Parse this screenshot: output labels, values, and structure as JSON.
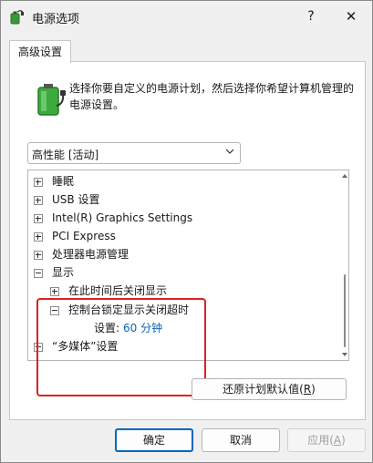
{
  "window": {
    "title": "电源选项",
    "help_label": "?",
    "close_label": "✕"
  },
  "tabs": [
    {
      "label": "高级设置",
      "active": true
    }
  ],
  "description": "选择你要自定义的电源计划，然后选择你希望计算机管理的电源设置。",
  "plan_select": {
    "value": "高性能 [活动]"
  },
  "tree": {
    "items": [
      {
        "label": "睡眠",
        "expander": "plus"
      },
      {
        "label": "USB 设置",
        "expander": "plus"
      },
      {
        "label": "Intel(R) Graphics Settings",
        "expander": "plus"
      },
      {
        "label": "PCI Express",
        "expander": "plus"
      },
      {
        "label": "处理器电源管理",
        "expander": "plus"
      },
      {
        "label": "显示",
        "expander": "minus"
      },
      {
        "label": "在此时间后关闭显示",
        "expander": "plus"
      },
      {
        "label": "控制台锁定显示关闭超时",
        "expander": "minus"
      },
      {
        "setting_label": "设置:",
        "setting_value": "60 分钟"
      },
      {
        "label": "“多媒体”设置",
        "expander": "plus"
      }
    ]
  },
  "buttons": {
    "restore_defaults_prefix": "还原计划默认值(",
    "restore_defaults_key": "R",
    "restore_defaults_suffix": ")",
    "ok": "确定",
    "cancel": "取消",
    "apply_prefix": "应用(",
    "apply_key": "A",
    "apply_suffix": ")"
  },
  "colors": {
    "highlight_border": "#e02020",
    "setting_value": "#0a64b4",
    "ok_border": "#0067c0"
  }
}
